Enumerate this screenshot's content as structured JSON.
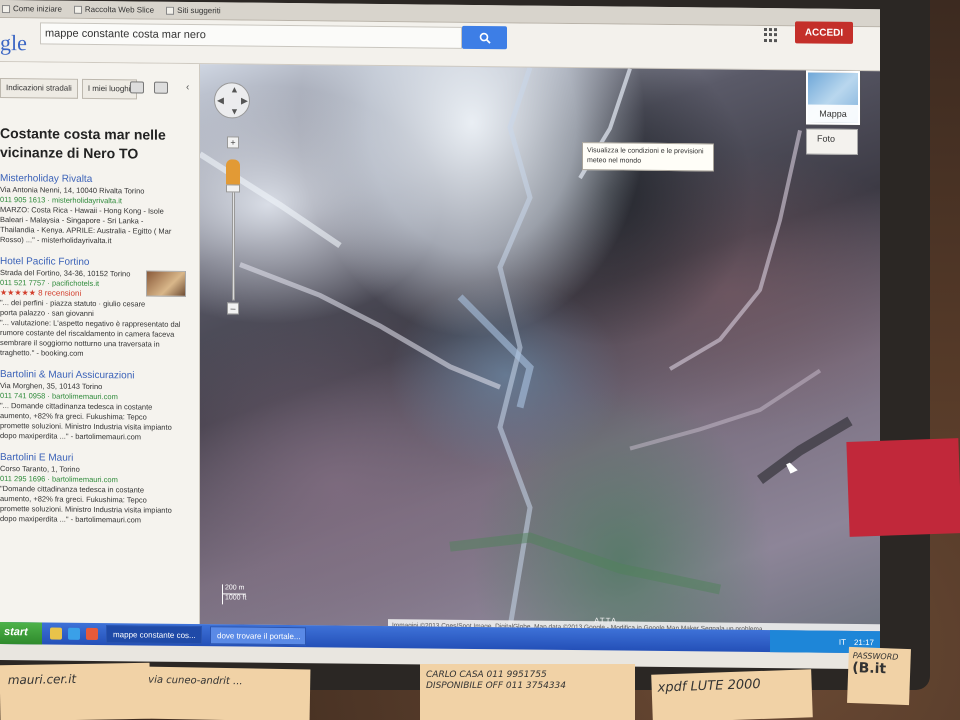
{
  "favorites": {
    "items": [
      "Come iniziare",
      "Raccolta Web Slice",
      "Siti suggeriti"
    ]
  },
  "header": {
    "logo": "gle",
    "search_value": "mappe constante costa mar nero",
    "signin_label": "ACCEDI"
  },
  "left_panel": {
    "tabs": [
      "Indicazioni stradali",
      "I miei luoghi"
    ],
    "title": "Costante costa mar nelle vicinanze di Nero TO",
    "results": [
      {
        "name": "Misterholiday Rivalta",
        "lines": [
          "Via Antonia Nenni, 14, 10040 Rivalta Torino",
          "011 905 1613 · misterholidayrivalta.it",
          "MARZO: Costa Rica - Hawaii - Hong Kong - Isole",
          "Baleari - Malaysia - Singapore - Sri Lanka -",
          "Thailandia - Kenya. APRILE: Australia - Egitto ( Mar",
          "Rosso) ...\" - misterholidayrivalta.it"
        ]
      },
      {
        "name": "Hotel Pacific Fortino",
        "lines": [
          "Strada del Fortino, 34-36, 10152 Torino",
          "011 521 7757 · pacifichotels.it",
          "★★★★★ 8 recensioni",
          "\"... dei perfini · piazza statuto · giulio cesare",
          "porta palazzo · san giovanni",
          "\"... valutazione: L'aspetto negativo è rappresentato dal",
          "rumore costante del riscaldamento in camera faceva",
          "sembrare il soggiorno notturno una traversata in",
          "traghetto.\" - booking.com"
        ]
      },
      {
        "name": "Bartolini & Mauri Assicurazioni",
        "lines": [
          "Via Morghen, 35, 10143 Torino",
          "011 741 0958 · bartolimemauri.com",
          "\"... Domande cittadinanza tedesca in costante",
          "aumento, +82% fra greci. Fukushima: Tepco",
          "promette soluzioni. Ministro Industria visita impianto",
          "dopo maxiperdita ...\" - bartolimemauri.com"
        ]
      },
      {
        "name": "Bartolini E Mauri",
        "lines": [
          "Corso Taranto, 1, Torino",
          "011 295 1696 · bartolimemauri.com",
          "\"Domande cittadinanza tedesca in costante",
          "aumento, +82% fra greci. Fukushima: Tepco",
          "promette soluzioni. Ministro Industria visita impianto",
          "dopo maxiperdita ...\" - bartolimemauri.com"
        ]
      }
    ]
  },
  "map": {
    "tooltip": "Visualizza le condizioni e le previsioni meteo nel mondo",
    "maptype_label": "Mappa",
    "foto_label": "Foto",
    "scale_top": "200 m",
    "scale_bottom": "1000 ft",
    "watermark": "ATTA",
    "attribution": "Immagini ©2013 Cnes/Spot Image, DigitalGlobe, Map data ©2013 Google -   Modifica in Google Map Maker    Segnala un problema"
  },
  "taskbar": {
    "start_label": "start",
    "tasks": [
      "mappe constante cos...",
      "dove trovare il portale..."
    ],
    "tray_lang": "IT",
    "clock": "21:17"
  },
  "desk_notes": {
    "note1": "mauri.cer.it",
    "note2": "via cuneo-andrit ...",
    "note3_line1": "CARLO CASA 011 9951755",
    "note3_line2": "DISPONIBILE OFF 011 3754334",
    "note4": "xpdf LUTE 2000",
    "note5_line1": "PASSWORD",
    "note5_line2": "(B.it"
  },
  "colors": {
    "search_button": "#3d7ee6",
    "signin_button": "#c42f2a",
    "link_green": "#2e8a3a",
    "result_name": "#3b62b8",
    "taskbar": "#2450b8"
  }
}
